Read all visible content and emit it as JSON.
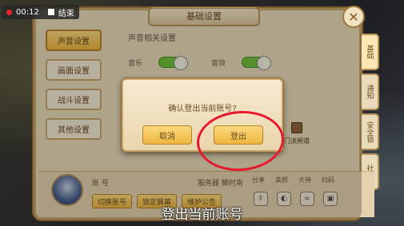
{
  "recording": {
    "time": "00:12",
    "stop_label": "结束"
  },
  "panel": {
    "title": "基础设置",
    "close_glyph": "✕"
  },
  "left_menu": [
    {
      "label": "声音设置",
      "active": true
    },
    {
      "label": "画面设置",
      "active": false
    },
    {
      "label": "战斗设置",
      "active": false
    },
    {
      "label": "其他设置",
      "active": false
    }
  ],
  "content": {
    "section_title": "声音相关设置",
    "music_label": "音乐",
    "sound_label": "音效",
    "checkbox_label": "门派频道"
  },
  "right_tabs": [
    {
      "label": "基础",
      "active": true
    },
    {
      "label": "通知",
      "active": false
    },
    {
      "label": "安全锁",
      "active": false
    },
    {
      "label": "社区",
      "active": false
    }
  ],
  "profile": {
    "account_label": "账 号",
    "server_label": "服务器 鲫时南",
    "buttons": [
      "切换账号",
      "锁定屏幕",
      "维护公告"
    ],
    "share_labels": [
      "分享",
      "美颜",
      "大神",
      "扫码"
    ],
    "share_icons": [
      "share-icon",
      "beauty-icon",
      "link-icon",
      "scan-icon"
    ],
    "share_glyphs": [
      "⇪",
      "◐",
      "∞",
      "▣"
    ]
  },
  "dialog": {
    "message": "确认登出当前账号?",
    "cancel_label": "取消",
    "logout_label": "登出"
  },
  "caption": "登出当前账号",
  "colors": {
    "annotation": "#e8192c",
    "button_gold": "#eeb63f",
    "panel_bg": "#e9dbb9"
  }
}
